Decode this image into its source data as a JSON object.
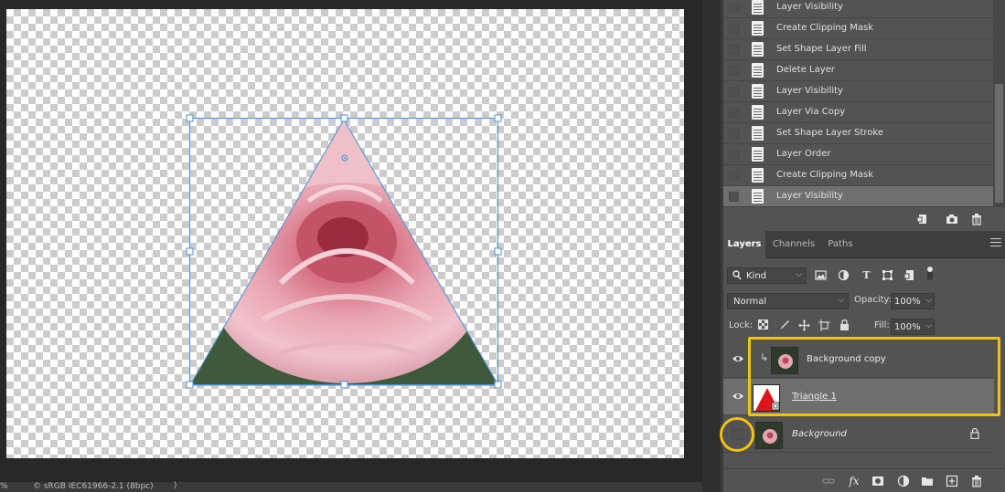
{
  "status_bar": {
    "zoom": "%",
    "profile": "© sRGB IEC61966-2.1 (8bpc)",
    "arrow": "⟩"
  },
  "history": {
    "items": [
      {
        "label": "Layer Visibility"
      },
      {
        "label": "Create Clipping Mask"
      },
      {
        "label": "Set Shape Layer Fill"
      },
      {
        "label": "Delete Layer"
      },
      {
        "label": "Layer Visibility"
      },
      {
        "label": "Layer Via Copy"
      },
      {
        "label": "Set Shape Layer Stroke"
      },
      {
        "label": "Layer Order"
      },
      {
        "label": "Create Clipping Mask"
      },
      {
        "label": "Layer Visibility"
      }
    ],
    "active_index": 9,
    "footer_icons": [
      "new-snapshot-from-state-icon",
      "camera-icon",
      "trash-icon"
    ]
  },
  "layers_panel": {
    "tabs": [
      {
        "label": "Layers",
        "active": true
      },
      {
        "label": "Channels",
        "active": false
      },
      {
        "label": "Paths",
        "active": false
      }
    ],
    "filter": {
      "value": "Kind"
    },
    "blend_mode": {
      "value": "Normal"
    },
    "opacity": {
      "label": "Opacity:",
      "value": "100%"
    },
    "lock": {
      "label": "Lock:"
    },
    "fill": {
      "label": "Fill:",
      "value": "100%"
    },
    "layers": [
      {
        "name": "Background copy",
        "visible": true,
        "clipped": true,
        "selected": false
      },
      {
        "name": "Triangle 1",
        "visible": true,
        "clipped": false,
        "selected": true
      },
      {
        "name": "Background",
        "visible": false,
        "clipped": false,
        "selected": false,
        "locked": true
      }
    ]
  },
  "colors": {
    "highlight": "#f4c20d",
    "selection_handles": "#4a90d9",
    "triangle_thumb_fill": "#e0151b"
  }
}
